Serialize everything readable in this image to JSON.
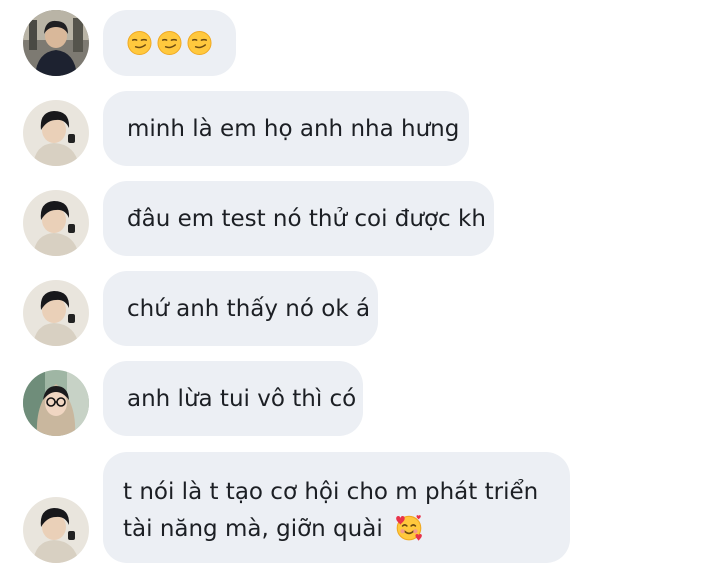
{
  "messages": [
    {
      "sender": "friend-a",
      "emojis": [
        "smirking-face",
        "smirking-face",
        "smirking-face"
      ]
    },
    {
      "sender": "friend-b",
      "text": "minh là em họ anh nha hưng"
    },
    {
      "sender": "friend-b",
      "text": "đâu em test nó thử coi được kh"
    },
    {
      "sender": "friend-b",
      "text": "chứ anh thấy nó ok á"
    },
    {
      "sender": "friend-c",
      "text": "anh lừa tui vô thì có"
    },
    {
      "sender": "friend-b",
      "line1": "t nói là t tạo cơ hội cho m phát triển",
      "line2": "tài năng mà, giỡn quài",
      "emoji": "smiling-face-with-hearts"
    }
  ],
  "colors": {
    "bubble": "#eceff4",
    "text": "#1c1f24",
    "emoji_face": "#ffc83d",
    "heart": "#e8334a"
  }
}
